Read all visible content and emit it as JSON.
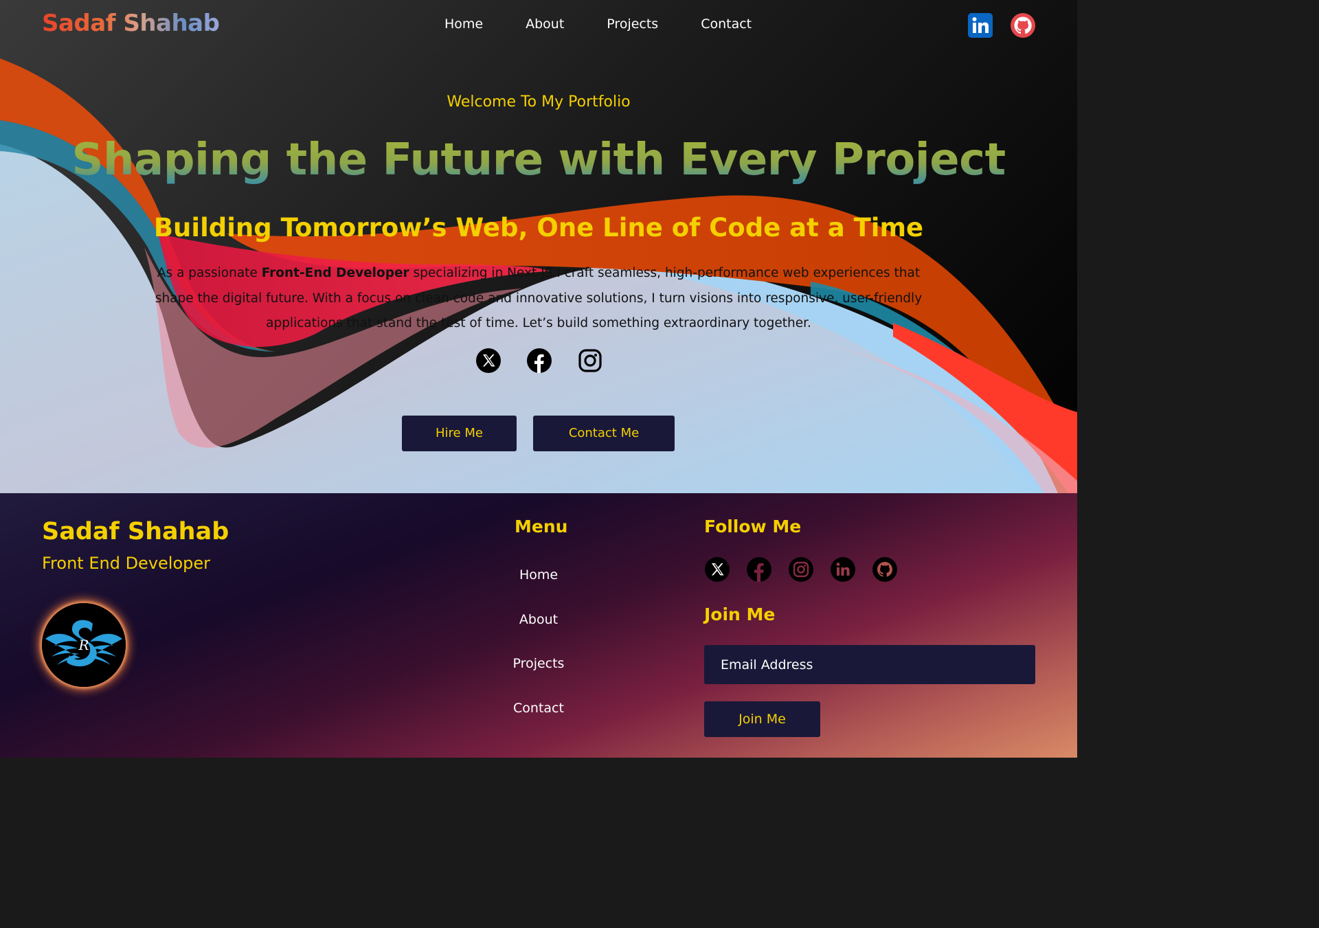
{
  "header": {
    "logo_text": "Sadaf Shahab",
    "nav": [
      {
        "label": "Home"
      },
      {
        "label": "About"
      },
      {
        "label": "Projects"
      },
      {
        "label": "Contact"
      }
    ],
    "social_icons": [
      "linkedin-icon",
      "github-icon"
    ]
  },
  "hero": {
    "welcome": "Welcome To My Portfolio",
    "headline": "Shaping the Future with Every Project",
    "subheadline": "Building Tomorrow’s Web, One Line of Code at a Time",
    "intro_prefix": "As a passionate ",
    "intro_bold": "Front-End Developer",
    "intro_suffix": " specializing in Next JS I craft seamless, high-performance web experiences that shape the digital future. With a focus on clean code and innovative solutions, I turn visions into responsive, user-friendly applications that stand the test of time. Let’s build something extraordinary together.",
    "social_icons": [
      "x-icon",
      "facebook-icon",
      "instagram-icon"
    ],
    "hire_button": "Hire Me",
    "contact_button": "Contact Me"
  },
  "footer": {
    "name": "Sadaf Shahab",
    "role": "Front End Developer",
    "menu_title": "Menu",
    "menu": [
      {
        "label": "Home"
      },
      {
        "label": "About"
      },
      {
        "label": "Projects"
      },
      {
        "label": "Contact"
      }
    ],
    "follow_title": "Follow Me",
    "social_icons": [
      "x-icon",
      "facebook-icon",
      "instagram-icon",
      "linkedin-icon",
      "github-icon"
    ],
    "join_title": "Join Me",
    "email_placeholder": "Email Address",
    "join_button": "Join Me"
  },
  "colors": {
    "accent_yellow": "#f4d000",
    "button_bg": "#1a1838",
    "linkedin_blue": "#0a66c2",
    "github_red": "#e5484d"
  }
}
